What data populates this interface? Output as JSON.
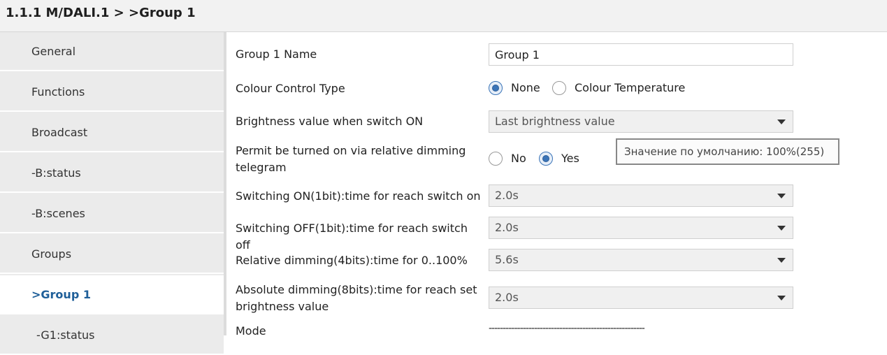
{
  "header": {
    "title": "1.1.1 M/DALI.1 >  >Group 1"
  },
  "sidebar": {
    "items": [
      {
        "label": "General"
      },
      {
        "label": "Functions"
      },
      {
        "label": "Broadcast"
      },
      {
        "label": "-B:status"
      },
      {
        "label": "-B:scenes"
      },
      {
        "label": "Groups"
      },
      {
        "label": ">Group 1",
        "active": true
      },
      {
        "label": "-G1:status"
      }
    ]
  },
  "params": {
    "group_name": {
      "label": "Group 1 Name",
      "value": "Group 1"
    },
    "colour_control": {
      "label": "Colour Control Type",
      "options": [
        "None",
        "Colour Temperature"
      ],
      "selected": "None"
    },
    "brightness_on": {
      "label": "Brightness value when switch ON",
      "value": "Last brightness value"
    },
    "permit_relative": {
      "label_line1": "Permit be turned on via relative dimming",
      "label_line2": "telegram",
      "options": [
        "No",
        "Yes"
      ],
      "selected": "Yes"
    },
    "switch_on_time": {
      "label": "Switching ON(1bit):time for reach switch on",
      "value": "2.0s"
    },
    "switch_off_time": {
      "label": "Switching OFF(1bit):time for reach switch off",
      "value": "2.0s"
    },
    "relative_dimming": {
      "label": "Relative dimming(4bits):time for 0..100%",
      "value": "5.6s"
    },
    "absolute_dimming": {
      "label_line1": "Absolute dimming(8bits):time for reach set",
      "label_line2": "brightness value",
      "value": "2.0s"
    },
    "mode": {
      "label": "Mode",
      "value": "-------------------------------------------------------"
    }
  },
  "tooltip": {
    "text": "Значение по умолчанию: 100%(255)"
  },
  "icons": {
    "dropdown": "chevron-down-icon",
    "radio": "radio-icon"
  },
  "colors": {
    "accent": "#3a74b8",
    "active_nav": "#1f5f99",
    "sidebar_bg": "#ebebeb",
    "header_bg": "#f2f2f2"
  }
}
